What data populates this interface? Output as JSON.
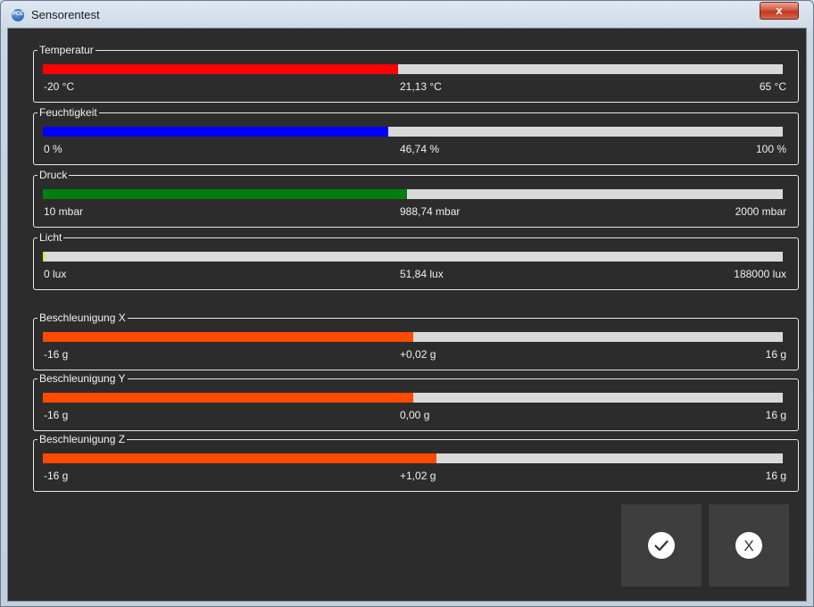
{
  "window": {
    "title": "Sensorentest",
    "logo_text": "PCE",
    "close_label": "x"
  },
  "sensors": [
    {
      "label": "Temperatur",
      "min": "-20 °C",
      "value": "21,13 °C",
      "max": "65 °C",
      "fill": 0.48,
      "color": "#ff0000"
    },
    {
      "label": "Feuchtigkeit",
      "min": "0 %",
      "value": "46,74 %",
      "max": "100 %",
      "fill": 0.4674,
      "color": "#0000ff"
    },
    {
      "label": "Druck",
      "min": "10 mbar",
      "value": "988,74 mbar",
      "max": "2000 mbar",
      "fill": 0.4918,
      "color": "#007f0e"
    },
    {
      "label": "Licht",
      "min": "0 lux",
      "value": "51,84 lux",
      "max": "188000 lux",
      "fill": 0.003,
      "color": "#f0e000"
    },
    {
      "label": "Beschleunigung X",
      "min": "-16 g",
      "value": "+0,02 g",
      "max": "16 g",
      "fill": 0.5006,
      "color": "#ff4a00"
    },
    {
      "label": "Beschleunigung Y",
      "min": "-16 g",
      "value": "0,00 g",
      "max": "16 g",
      "fill": 0.5,
      "color": "#ff4a00"
    },
    {
      "label": "Beschleunigung Z",
      "min": "-16 g",
      "value": "+1,02 g",
      "max": "16 g",
      "fill": 0.5319,
      "color": "#ff4a00"
    }
  ],
  "buttons": {
    "ok_icon": "checkmark-icon",
    "cancel_label": "X"
  }
}
